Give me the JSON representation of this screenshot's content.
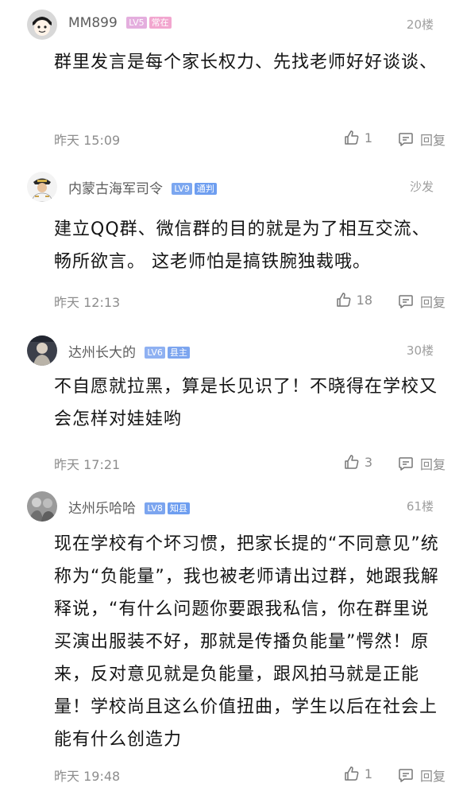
{
  "comments": [
    {
      "username": "MM899",
      "level": "LV5",
      "title": "常在",
      "level_color": "#d9a0d6",
      "title_color": "#ef9cc9",
      "floor": "20楼",
      "content": "群里发言是每个家长权力、先找老师好好谈谈、",
      "time": "昨天 15:09",
      "likes": "1",
      "reply_label": "回复",
      "avatar_icon": "cartoon-face-avatar"
    },
    {
      "username": "内蒙古海军司令",
      "level": "LV9",
      "title": "通判",
      "level_color": "#7ca7f0",
      "title_color": "#6e9ef0",
      "floor": "沙发",
      "content": "建立QQ群、微信群的目的就是为了相互交流、畅所欲言。 这老师怕是搞铁腕独裁哦。",
      "time": "昨天 12:13",
      "likes": "18",
      "reply_label": "回复",
      "avatar_icon": "navy-officer-avatar"
    },
    {
      "username": "达州长大的",
      "level": "LV6",
      "title": "县主",
      "level_color": "#8fb1f2",
      "title_color": "#7ca5ef",
      "floor": "30楼",
      "content": "不自愿就拉黑，算是长见识了！不晓得在学校又会怎样对娃娃哟",
      "time": "昨天 17:21",
      "likes": "3",
      "reply_label": "回复",
      "avatar_icon": "photo-avatar"
    },
    {
      "username": "达州乐哈哈",
      "level": "LV8",
      "title": "知县",
      "level_color": "#7ca5ef",
      "title_color": "#6e9ef0",
      "floor": "61楼",
      "content": "现在学校有个坏习惯，把家长提的“不同意见”统称为“负能量”，我也被老师请出过群，她跟我解释说，“有什么问题你要跟我私信，你在群里说买演出服装不好，那就是传播负能量”愕然！原来，反对意见就是负能量，跟风拍马就是正能量！学校尚且这么价值扭曲，学生以后在社会上能有什么创造力",
      "time": "昨天 19:48",
      "likes": "1",
      "reply_label": "回复",
      "avatar_icon": "gray-photo-avatar"
    }
  ]
}
